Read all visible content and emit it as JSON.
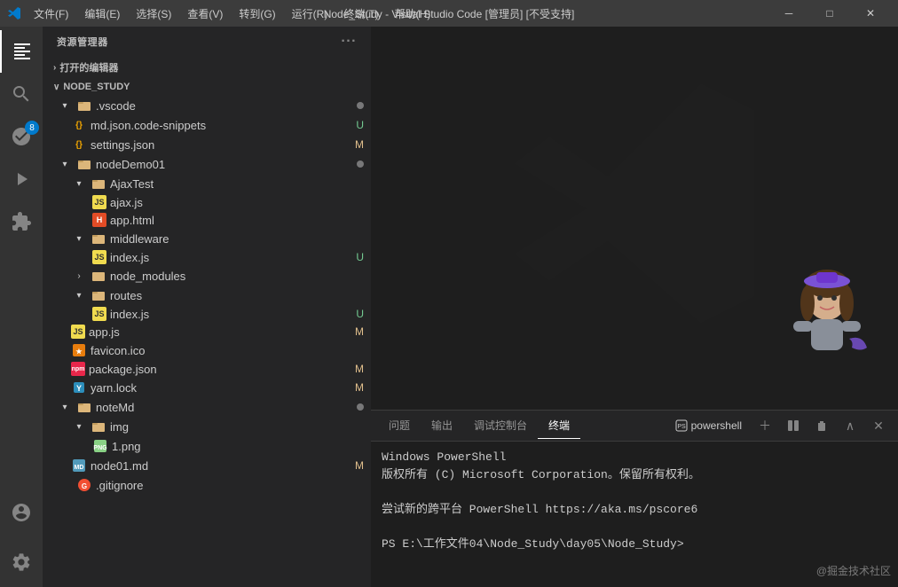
{
  "titlebar": {
    "title": "Node_Study - Visual Studio Code [管理员] [不受支持]",
    "menu": [
      "文件(F)",
      "编辑(E)",
      "选择(S)",
      "查看(V)",
      "转到(G)",
      "运行(R)",
      "终端(T)",
      "帮助(H)"
    ],
    "controls": {
      "minimize": "─",
      "restore": "□",
      "close": "✕"
    }
  },
  "sidebar": {
    "header": "资源管理器",
    "header_more": "···",
    "open_editors": "打开的编辑器",
    "project": "NODE_STUDY",
    "items": [
      {
        "level": 1,
        "type": "folder-open",
        "label": ".vscode",
        "badge": "",
        "dot": true
      },
      {
        "level": 2,
        "type": "json",
        "label": "md.json.code-snippets",
        "badge": "U"
      },
      {
        "level": 2,
        "type": "json",
        "label": "settings.json",
        "badge": "M"
      },
      {
        "level": 1,
        "type": "folder-open",
        "label": "nodeDemo01",
        "badge": "",
        "dot": true
      },
      {
        "level": 2,
        "type": "folder-open",
        "label": "AjaxTest",
        "badge": ""
      },
      {
        "level": 3,
        "type": "js",
        "label": "ajax.js",
        "badge": ""
      },
      {
        "level": 3,
        "type": "html",
        "label": "app.html",
        "badge": ""
      },
      {
        "level": 2,
        "type": "folder-open",
        "label": "middleware",
        "badge": ""
      },
      {
        "level": 3,
        "type": "js",
        "label": "index.js",
        "badge": "U"
      },
      {
        "level": 2,
        "type": "folder",
        "label": "node_modules",
        "badge": ""
      },
      {
        "level": 2,
        "type": "folder-open",
        "label": "routes",
        "badge": ""
      },
      {
        "level": 3,
        "type": "js",
        "label": "index.js",
        "badge": "U"
      },
      {
        "level": 2,
        "type": "js",
        "label": "app.js",
        "badge": "M"
      },
      {
        "level": 2,
        "type": "ico",
        "label": "favicon.ico",
        "badge": ""
      },
      {
        "level": 2,
        "type": "json",
        "label": "package.json",
        "badge": "M"
      },
      {
        "level": 2,
        "type": "lock",
        "label": "yarn.lock",
        "badge": "M"
      },
      {
        "level": 1,
        "type": "folder-open",
        "label": "noteMd",
        "badge": "",
        "dot": true
      },
      {
        "level": 2,
        "type": "folder-open",
        "label": "img",
        "badge": ""
      },
      {
        "level": 3,
        "type": "img",
        "label": "1.png",
        "badge": ""
      },
      {
        "level": 2,
        "type": "md",
        "label": "node01.md",
        "badge": "M"
      },
      {
        "level": 1,
        "type": "git",
        "label": ".gitignore",
        "badge": ""
      }
    ]
  },
  "terminal": {
    "tabs": [
      "问题",
      "输出",
      "调试控制台",
      "终端"
    ],
    "active_tab": "终端",
    "powershell": "powershell",
    "content": [
      "Windows PowerShell",
      "版权所有 (C) Microsoft Corporation。保留所有权利。",
      "",
      "尝试新的跨平台 PowerShell https://aka.ms/pscore6",
      "",
      "PS E:\\工作文件04\\Node_Study\\day05\\Node_Study>"
    ]
  },
  "watermark": "@掘金技术社区",
  "activity": {
    "badge_count": "8"
  }
}
